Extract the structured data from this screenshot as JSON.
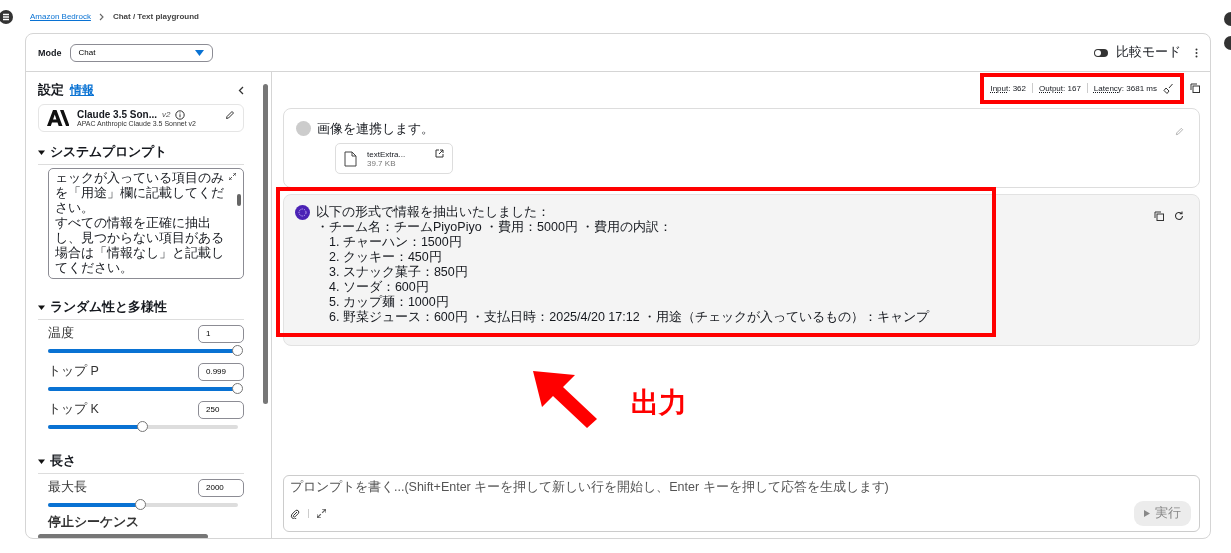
{
  "breadcrumb": {
    "link": "Amazon Bedrock",
    "current": "Chat / Text playground"
  },
  "header": {
    "mode_label": "Mode",
    "mode_value": "Chat",
    "compare_label": "比較モード",
    "compare_on": false
  },
  "sidebar": {
    "title": "設定",
    "info_link": "情報",
    "model": {
      "name": "Claude 3.5 Son...",
      "version": "v2",
      "subtitle": "APAC Anthropic Claude 3.5 Sonnet v2"
    },
    "sections": [
      {
        "title": "システムプロンプト",
        "expanded": true,
        "kind": "prompt",
        "lines": [
          "ェックが入っている項目のみを「用途」欄に記載してください。",
          "すべての情報を正確に抽出し、見つからない項目がある場合は「情報なし」と記載してください。"
        ]
      },
      {
        "title": "ランダム性と多様性",
        "expanded": true,
        "kind": "params",
        "params": [
          {
            "label": "温度",
            "value": "1",
            "level": 1.0
          },
          {
            "label": "トップ P",
            "value": "0.999",
            "level": 0.999
          },
          {
            "label": "トップ K",
            "value": "250",
            "level": 0.5
          }
        ]
      },
      {
        "title": "長さ",
        "expanded": true,
        "kind": "params",
        "params": [
          {
            "label": "最大長",
            "value": "2000",
            "level": 0.49
          }
        ],
        "footer": "停止シーケンス"
      }
    ]
  },
  "metrics": {
    "highlighted": true,
    "items": [
      {
        "label": "Input",
        "value": ": 362"
      },
      {
        "label": "Output",
        "value": ": 167"
      },
      {
        "label": "Latency",
        "value": ": 3681 ms"
      }
    ]
  },
  "user_message": {
    "text": "画像を連携します。",
    "attachment": {
      "name": "textExtra...",
      "size": "39.7 KB"
    }
  },
  "response": {
    "highlighted": true,
    "lines": [
      {
        "kind": "text",
        "text": "以下の形式で情報を抽出いたしました："
      },
      {
        "kind": "text",
        "text": "・チーム名：チームPiyoPiyo ・費用：5000円 ・費用の内訳："
      },
      {
        "kind": "item",
        "text": "1. チャーハン：1500円"
      },
      {
        "kind": "item",
        "text": "2. クッキー：450円"
      },
      {
        "kind": "item",
        "text": "3. スナック菓子：850円"
      },
      {
        "kind": "item",
        "text": "4. ソーダ：600円"
      },
      {
        "kind": "item",
        "text": "5. カップ麺：1000円"
      },
      {
        "kind": "item",
        "text": "6. 野菜ジュース：600円 ・支払日時：2025/4/20 17:12 ・用途（チェックが入っているもの）：キャンプ"
      }
    ]
  },
  "annotation": {
    "label": "出力"
  },
  "composer": {
    "placeholder": "プロンプトを書く...(Shift+Enter キーを押して新しい行を開始し、Enter キーを押して応答を生成します)",
    "run_label": "実行",
    "run_disabled": true
  }
}
